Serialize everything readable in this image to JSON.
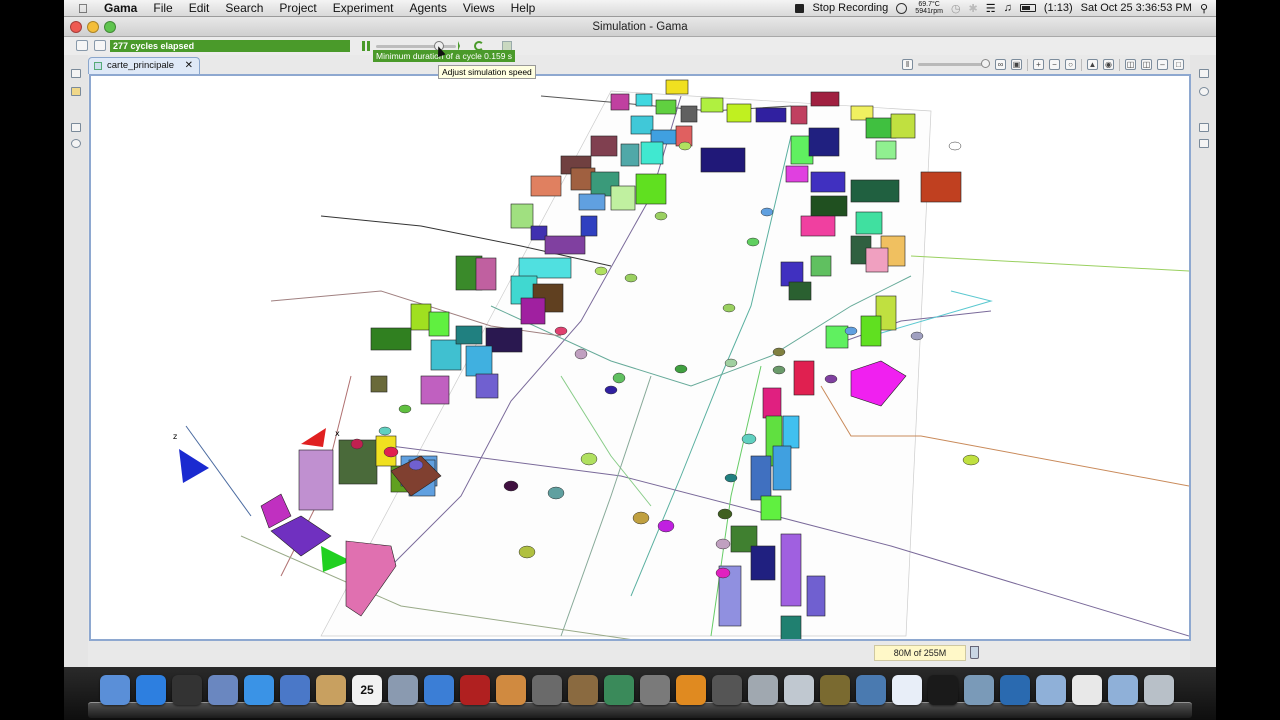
{
  "menubar": {
    "app_name": "Gama",
    "items": [
      "File",
      "Edit",
      "Search",
      "Project",
      "Experiment",
      "Agents",
      "Views",
      "Help"
    ],
    "stop_recording": "Stop Recording",
    "temp_line1": "69.7°C",
    "temp_line2": "5941rpm",
    "battery": "(1:13)",
    "clock": "Sat Oct 25  3:36:53 PM"
  },
  "window": {
    "title": "Simulation - Gama"
  },
  "toolbar": {
    "cycles_label": "277 cycles elapsed",
    "tooltip_min_duration": "Minimum duration of a cycle 0.159 s",
    "tooltip_adjust": "Adjust simulation speed"
  },
  "tab": {
    "label": "carte_principale",
    "close_glyph": "✕"
  },
  "statusbar": {
    "memory": "80M of 255M"
  },
  "colors": {
    "accent_green": "#4a9a2a",
    "tab_border": "#8aa6cc",
    "display_border": "#8ea8d0"
  },
  "dock": {
    "items": [
      {
        "name": "finder-icon",
        "color": "#5a8fd8"
      },
      {
        "name": "app-store-icon",
        "color": "#2d7fe0"
      },
      {
        "name": "dashboard-icon",
        "color": "#333333"
      },
      {
        "name": "mail-stamp-icon",
        "color": "#6a87c0"
      },
      {
        "name": "safari-icon",
        "color": "#3a93e6"
      },
      {
        "name": "facetime-icon",
        "color": "#4a78c8"
      },
      {
        "name": "address-book-icon",
        "color": "#c8a060"
      },
      {
        "name": "calendar-icon",
        "color": "#f2f2f2",
        "text": "25"
      },
      {
        "name": "photo-icon",
        "color": "#8a9ab0"
      },
      {
        "name": "itunes-icon",
        "color": "#3b7ed6"
      },
      {
        "name": "photo-booth-icon",
        "color": "#b02020"
      },
      {
        "name": "iphoto-icon",
        "color": "#d08a40"
      },
      {
        "name": "imovie-icon",
        "color": "#6a6a6a"
      },
      {
        "name": "garageband-icon",
        "color": "#8a6a40"
      },
      {
        "name": "time-machine-icon",
        "color": "#3a8a5a"
      },
      {
        "name": "system-preferences-icon",
        "color": "#7a7a7a"
      },
      {
        "name": "sublime-icon",
        "color": "#e08a20"
      },
      {
        "name": "camera-icon",
        "color": "#555555"
      },
      {
        "name": "monitor-icon",
        "color": "#a0a8b0"
      },
      {
        "name": "preview-icon",
        "color": "#c0c8d0"
      },
      {
        "name": "gama-icon",
        "color": "#7a6a30"
      },
      {
        "name": "virtualbox-icon",
        "color": "#4a7ab0"
      },
      {
        "name": "globe-icon",
        "color": "#e8eef8"
      },
      {
        "name": "terminal-icon",
        "color": "#1a1a1a"
      },
      {
        "name": "network-icon",
        "color": "#7a9ab8"
      },
      {
        "name": "quicktime-icon",
        "color": "#2a6ab0"
      },
      {
        "name": "applications-folder-icon",
        "color": "#8fb0d8"
      },
      {
        "name": "document-icon",
        "color": "#e8e8e8"
      },
      {
        "name": "downloads-folder-icon",
        "color": "#8fb0d8"
      },
      {
        "name": "trash-icon",
        "color": "#b8c0c8"
      }
    ]
  }
}
